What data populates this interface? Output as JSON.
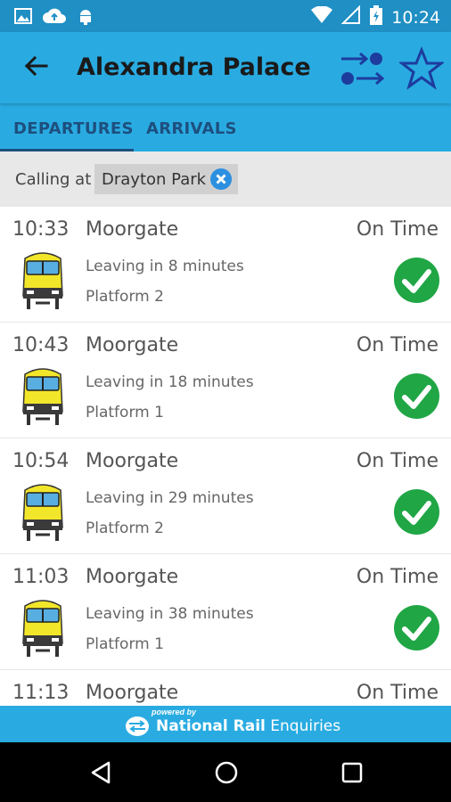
{
  "status_bar": {
    "time": "10:24",
    "left_icons": [
      "image-icon",
      "cloud-upload-icon",
      "android-icon"
    ],
    "right_icons": [
      "wifi-icon",
      "signal-icon",
      "battery-icon"
    ]
  },
  "app_bar": {
    "title": "Alexandra Palace",
    "back_icon": "arrow-back-icon",
    "actions": [
      "swap-direction-icon",
      "star-icon"
    ],
    "color": "#29abe2"
  },
  "tabs": [
    {
      "label": "DEPARTURES",
      "selected": true
    },
    {
      "label": "ARRIVALS",
      "selected": false
    }
  ],
  "filter": {
    "label": "Calling at",
    "chip": "Drayton Park"
  },
  "departures": [
    {
      "time": "10:33",
      "destination": "Moorgate",
      "status": "On Time",
      "leaving": "Leaving in 8 minutes",
      "platform": "Platform 2"
    },
    {
      "time": "10:43",
      "destination": "Moorgate",
      "status": "On Time",
      "leaving": "Leaving in 18 minutes",
      "platform": "Platform 1"
    },
    {
      "time": "10:54",
      "destination": "Moorgate",
      "status": "On Time",
      "leaving": "Leaving in 29 minutes",
      "platform": "Platform 2"
    },
    {
      "time": "11:03",
      "destination": "Moorgate",
      "status": "On Time",
      "leaving": "Leaving in 38 minutes",
      "platform": "Platform 1"
    },
    {
      "time": "11:13",
      "destination": "Moorgate",
      "status": "On Time",
      "leaving": "",
      "platform": ""
    }
  ],
  "footer": {
    "powered_by": "powered by",
    "brand_bold": "National Rail",
    "brand_light": " Enquiries"
  },
  "nav": [
    "back-triangle-icon",
    "home-circle-icon",
    "recents-square-icon"
  ],
  "colors": {
    "status_ok": "#20a645",
    "tab_text": "#1d4f7e",
    "status_bar": "#1f8fc4"
  }
}
